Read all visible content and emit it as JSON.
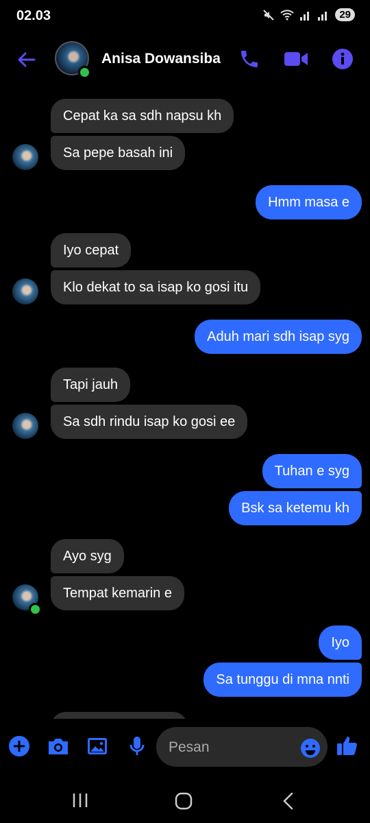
{
  "status": {
    "time": "02.03",
    "battery": "29"
  },
  "header": {
    "contact_name": "Anisa Dowansiba"
  },
  "messages": [
    {
      "text": "Cepat ka sa sdh napsu kh",
      "dir": "in"
    },
    {
      "text": "Sa pepe basah ini",
      "dir": "in"
    },
    {
      "text": "Hmm masa e",
      "dir": "out"
    },
    {
      "text": "Iyo cepat",
      "dir": "in"
    },
    {
      "text": "Klo dekat to sa isap ko gosi itu",
      "dir": "in"
    },
    {
      "text": "Aduh mari sdh isap syg",
      "dir": "out"
    },
    {
      "text": "Tapi jauh",
      "dir": "in"
    },
    {
      "text": "Sa sdh rindu isap ko gosi ee",
      "dir": "in"
    },
    {
      "text": "Tuhan e syg",
      "dir": "out"
    },
    {
      "text": "Bsk sa ketemu kh",
      "dir": "out"
    },
    {
      "text": "Ayo syg",
      "dir": "in"
    },
    {
      "text": "Tempat kemarin e",
      "dir": "in"
    },
    {
      "text": "Iyo",
      "dir": "out"
    },
    {
      "text": "Sa tunggu di mna nnti",
      "dir": "out"
    }
  ],
  "composer": {
    "placeholder": "Pesan"
  },
  "colors": {
    "accent": "#5a4cf0",
    "outgoing_bubble": "#2f6bff",
    "incoming_bubble": "#303030",
    "online": "#31c24d"
  }
}
